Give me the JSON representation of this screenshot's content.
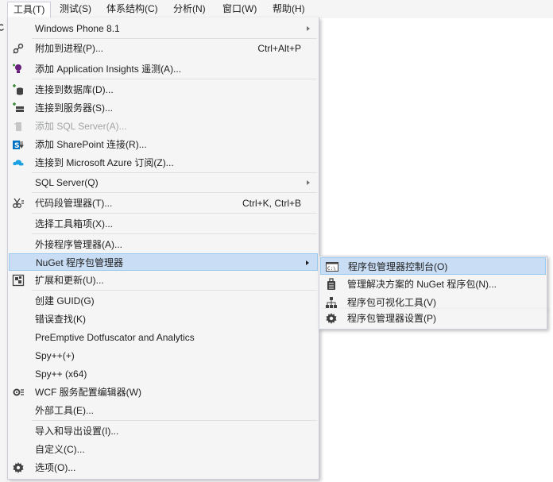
{
  "menubar": [
    {
      "label": "工具(T)",
      "active": true
    },
    {
      "label": "测试(S)"
    },
    {
      "label": "体系结构(C)"
    },
    {
      "label": "分析(N)"
    },
    {
      "label": "窗口(W)"
    },
    {
      "label": "帮助(H)"
    }
  ],
  "tools_menu": {
    "items": [
      {
        "label": "Windows Phone 8.1",
        "icon": "none",
        "submenu": true
      },
      {
        "label": "附加到进程(P)...",
        "shortcut": "Ctrl+Alt+P",
        "icon": "attach-process-icon"
      },
      {
        "label": "添加 Application Insights 遥测(A)...",
        "icon": "app-insights-icon"
      },
      {
        "label": "连接到数据库(D)...",
        "icon": "connect-database-icon"
      },
      {
        "label": "连接到服务器(S)...",
        "icon": "connect-server-icon"
      },
      {
        "label": "添加 SQL Server(A)...",
        "icon": "add-sql-server-icon",
        "disabled": true
      },
      {
        "label": "添加 SharePoint 连接(R)...",
        "icon": "sharepoint-icon"
      },
      {
        "label": "连接到 Microsoft Azure 订阅(Z)...",
        "icon": "azure-icon"
      },
      {
        "label": "SQL Server(Q)",
        "icon": "none",
        "submenu": true
      },
      {
        "label": "代码段管理器(T)...",
        "shortcut": "Ctrl+K, Ctrl+B",
        "icon": "code-snippet-icon"
      },
      {
        "label": "选择工具箱项(X)...",
        "icon": "none"
      },
      {
        "label": "外接程序管理器(A)...",
        "icon": "none"
      },
      {
        "label": "NuGet 程序包管理器",
        "icon": "none",
        "submenu": true,
        "highlighted": true
      },
      {
        "label": "扩展和更新(U)...",
        "icon": "extensions-icon"
      },
      {
        "label": "创建 GUID(G)",
        "icon": "none"
      },
      {
        "label": "错误查找(K)",
        "icon": "none"
      },
      {
        "label": "PreEmptive Dotfuscator and Analytics",
        "icon": "none"
      },
      {
        "label": "Spy++(+)",
        "icon": "none"
      },
      {
        "label": "Spy++ (x64)",
        "icon": "none"
      },
      {
        "label": "WCF 服务配置编辑器(W)",
        "icon": "wcf-config-icon"
      },
      {
        "label": "外部工具(E)...",
        "icon": "none"
      },
      {
        "label": "导入和导出设置(I)...",
        "icon": "none"
      },
      {
        "label": "自定义(C)...",
        "icon": "none"
      },
      {
        "label": "选项(O)...",
        "icon": "gear-icon"
      }
    ]
  },
  "nuget_submenu": {
    "items": [
      {
        "label": "程序包管理器控制台(O)",
        "icon": "console-icon",
        "highlighted": true
      },
      {
        "label": "管理解决方案的 NuGet 程序包(N)...",
        "icon": "nuget-package-icon"
      },
      {
        "label": "程序包可视化工具(V)",
        "icon": "package-visualizer-icon"
      },
      {
        "label": "程序包管理器设置(P)",
        "icon": "gear-icon"
      }
    ]
  }
}
